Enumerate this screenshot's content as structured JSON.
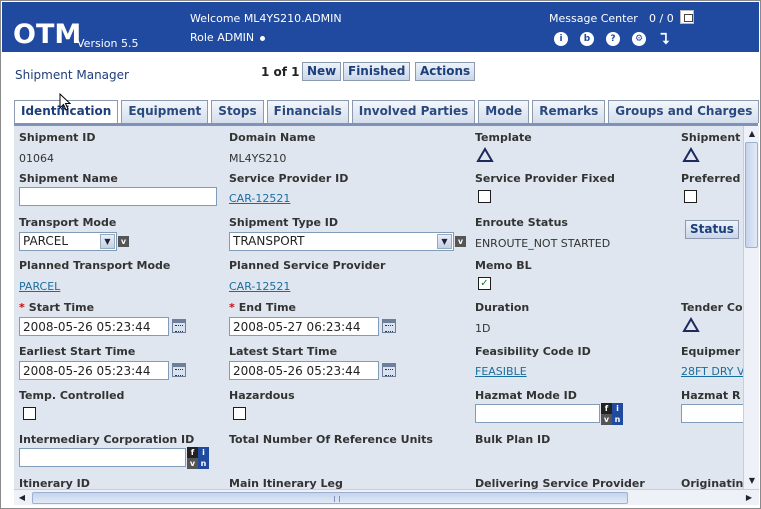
{
  "app": {
    "brand": "OTM",
    "version": "Version 5.5",
    "welcome": "Welcome ML4YS210.ADMIN",
    "role": "Role ADMIN",
    "message_center": "Message Center",
    "message_count": "0 / 0"
  },
  "page": {
    "title": "Shipment Manager",
    "pager": "1 of 1",
    "buttons": {
      "new": "New",
      "finished": "Finished",
      "actions": "Actions"
    }
  },
  "tabs": [
    "Identification",
    "Equipment",
    "Stops",
    "Financials",
    "Involved Parties",
    "Mode",
    "Remarks",
    "Groups and Charges"
  ],
  "form": {
    "shipment_id": {
      "label": "Shipment ID",
      "value": "01064"
    },
    "domain_name": {
      "label": "Domain Name",
      "value": "ML4YS210"
    },
    "template": {
      "label": "Template"
    },
    "shipment_col4": {
      "label": "Shipment"
    },
    "shipment_name": {
      "label": "Shipment Name",
      "value": ""
    },
    "service_provider_id": {
      "label": "Service Provider ID",
      "value": "CAR-12521"
    },
    "service_provider_fixed": {
      "label": "Service Provider Fixed",
      "checked": false
    },
    "preferred": {
      "label": "Preferred",
      "checked": false
    },
    "transport_mode": {
      "label": "Transport Mode",
      "value": "PARCEL"
    },
    "shipment_type_id": {
      "label": "Shipment Type ID",
      "value": "TRANSPORT"
    },
    "enroute_status": {
      "label": "Enroute Status",
      "value": "ENROUTE_NOT STARTED"
    },
    "status_button": "Status",
    "planned_transport_mode": {
      "label": "Planned Transport Mode",
      "value": "PARCEL"
    },
    "planned_service_provider": {
      "label": "Planned Service Provider",
      "value": "CAR-12521"
    },
    "memo_bl": {
      "label": "Memo BL",
      "checked": true,
      "mark": "✓"
    },
    "start_time": {
      "label": "Start Time",
      "value": "2008-05-26 05:23:44"
    },
    "end_time": {
      "label": "End Time",
      "value": "2008-05-27 06:23:44"
    },
    "duration": {
      "label": "Duration",
      "value": "1D"
    },
    "tender_col4": {
      "label": "Tender Co"
    },
    "earliest_start_time": {
      "label": "Earliest Start Time",
      "value": "2008-05-26 05:23:44"
    },
    "latest_start_time": {
      "label": "Latest Start Time",
      "value": "2008-05-26 05:23:44"
    },
    "feasibility_code_id": {
      "label": "Feasibility Code ID",
      "value": "FEASIBLE"
    },
    "equipment_col4": {
      "label": "Equipmer",
      "value": "28FT DRY V"
    },
    "temp_controlled": {
      "label": "Temp. Controlled",
      "checked": false
    },
    "hazardous": {
      "label": "Hazardous",
      "checked": false
    },
    "hazmat_mode_id": {
      "label": "Hazmat Mode ID",
      "value": ""
    },
    "hazmat_col4": {
      "label": "Hazmat R"
    },
    "intermediary_corporation_id": {
      "label": "Intermediary Corporation ID",
      "value": ""
    },
    "total_reference_units": {
      "label": "Total Number Of Reference Units"
    },
    "bulk_plan_id": {
      "label": "Bulk Plan ID"
    },
    "itinerary_id": {
      "label": "Itinerary ID"
    },
    "main_itinerary_leg": {
      "label": "Main Itinerary Leg"
    },
    "delivering_service_provider": {
      "label": "Delivering Service Provider"
    },
    "originating_col4": {
      "label": "Originatin"
    }
  },
  "required_marker": "*",
  "icons": {
    "header": [
      "info-icon",
      "book-icon",
      "help-icon",
      "settings-icon",
      "logout-icon"
    ],
    "header_glyphs": [
      "i",
      "b",
      "?",
      "⚙",
      "⮧"
    ],
    "fvin": {
      "f": "f",
      "i": "i",
      "v": "v",
      "n": "n"
    },
    "v_button": "v",
    "dropdown_arrow": "▼",
    "scroll_up": "▲",
    "scroll_down": "▼",
    "scroll_left": "◀",
    "scroll_right": "▶"
  },
  "colors": {
    "header_bg": "#1f4aa0",
    "link": "#1b6d9e",
    "required": "#dd0000",
    "content_bg": "#dfe6ef"
  }
}
